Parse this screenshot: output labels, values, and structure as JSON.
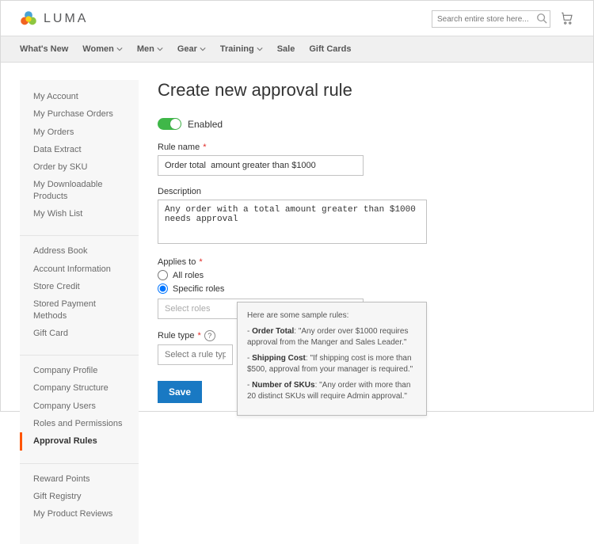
{
  "brand_name": "LUMA",
  "search": {
    "placeholder": "Search entire store here..."
  },
  "topnav": [
    {
      "label": "What's New",
      "dropdown": false
    },
    {
      "label": "Women",
      "dropdown": true
    },
    {
      "label": "Men",
      "dropdown": true
    },
    {
      "label": "Gear",
      "dropdown": true
    },
    {
      "label": "Training",
      "dropdown": true
    },
    {
      "label": "Sale",
      "dropdown": false
    },
    {
      "label": "Gift Cards",
      "dropdown": false
    }
  ],
  "sidebar": [
    {
      "items": [
        "My Account",
        "My Purchase Orders",
        "My Orders",
        "Data Extract",
        "Order by SKU",
        "My Downloadable Products",
        "My Wish List"
      ]
    },
    {
      "items": [
        "Address Book",
        "Account Information",
        "Store Credit",
        "Stored Payment Methods",
        "Gift Card"
      ]
    },
    {
      "items": [
        "Company Profile",
        "Company Structure",
        "Company Users",
        "Roles and Permissions",
        "Approval Rules"
      ]
    },
    {
      "items": [
        "Reward Points",
        "Gift Registry",
        "My Product Reviews"
      ]
    }
  ],
  "sidebar_active": "Approval Rules",
  "page_title": "Create new approval rule",
  "enabled": {
    "label": "Enabled",
    "on": true
  },
  "rule_name": {
    "label": "Rule name",
    "value": "Order total  amount greater than $1000"
  },
  "description": {
    "label": "Description",
    "value": "Any order with a total amount greater than $1000 needs approval"
  },
  "applies_to": {
    "label": "Applies to",
    "options": [
      "All roles",
      "Specific roles"
    ],
    "selected": "Specific roles",
    "roles_placeholder": "Select roles"
  },
  "rule_type": {
    "label": "Rule type",
    "placeholder": "Select a rule type"
  },
  "save_label": "Save",
  "tooltip": {
    "intro": "Here are some sample rules:",
    "rules": [
      {
        "name": "Order Total",
        "text": "\"Any order over $1000 requires approval from the Manger and Sales Leader.\""
      },
      {
        "name": "Shipping Cost",
        "text": "\"If shipping cost is more than $500, approval from your manager is required.\""
      },
      {
        "name": "Number of SKUs",
        "text": "\"Any order with more than 20 distinct SKUs will require Admin approval.\""
      }
    ]
  }
}
